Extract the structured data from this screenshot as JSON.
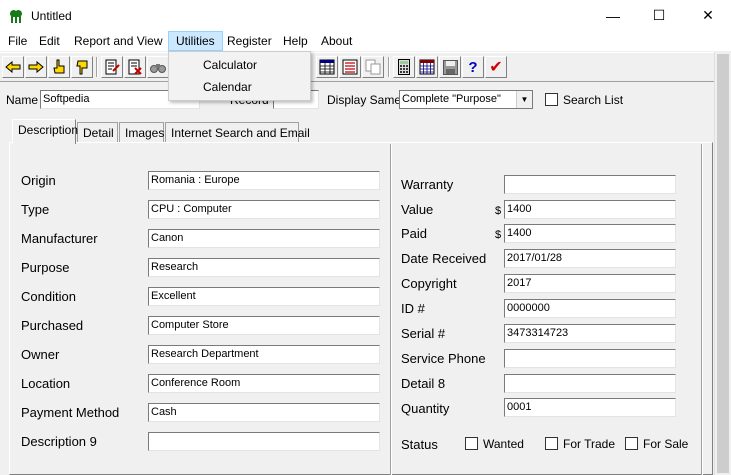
{
  "window": {
    "title": "Untitled",
    "minimize_glyph": "—",
    "maximize_glyph": "☐",
    "close_glyph": "✕"
  },
  "menu": {
    "items": [
      "File",
      "Edit",
      "Report and View",
      "Utilities",
      "Register",
      "Help",
      "About"
    ],
    "active": "Utilities"
  },
  "utilities_menu": {
    "items": [
      "Calculator",
      "Calendar"
    ]
  },
  "toolbar": {
    "icons": [
      "exit-icon",
      "enter-icon",
      "hand-pointer-icon",
      "hand-pointer-alt-icon",
      "document-edit-icon",
      "document-delete-icon",
      "binoculars-icon",
      "grid-icon",
      "list-icon",
      "copy-icon",
      "calculator-icon",
      "calendar-icon",
      "save-icon",
      "help-icon",
      "check-icon"
    ],
    "help_glyph": "?",
    "check_glyph": "✔"
  },
  "record_bar": {
    "name_label": "Name",
    "name_value": "Softpedia",
    "record_label": "Record",
    "record_value": "",
    "display_same_label": "Display Same",
    "display_same_value": "Complete \"Purpose\"",
    "search_list_label": "Search List",
    "search_list_checked": false
  },
  "tabs": [
    "Description",
    "Detail",
    "Images",
    "Internet Search and Email"
  ],
  "active_tab": "Description",
  "description": {
    "left": [
      {
        "label": "Origin",
        "value": "Romania  : Europe"
      },
      {
        "label": "Type",
        "value": "CPU : Computer"
      },
      {
        "label": "Manufacturer",
        "value": "Canon"
      },
      {
        "label": "Purpose",
        "value": "Research"
      },
      {
        "label": "Condition",
        "value": "Excellent"
      },
      {
        "label": "Purchased",
        "value": "Computer Store"
      },
      {
        "label": "Owner",
        "value": "Research Department"
      },
      {
        "label": "Location",
        "value": "Conference Room"
      },
      {
        "label": "Payment Method",
        "value": "Cash"
      },
      {
        "label": "Description 9",
        "value": ""
      }
    ],
    "right": [
      {
        "label": "Warranty",
        "value": ""
      },
      {
        "label": "Value",
        "value": "1400",
        "prefix": "$"
      },
      {
        "label": "Paid",
        "value": "1400",
        "prefix": "$"
      },
      {
        "label": "Date Received",
        "value": "2017/01/28"
      },
      {
        "label": "Copyright",
        "value": "2017"
      },
      {
        "label": "ID #",
        "value": "0000000"
      },
      {
        "label": "Serial #",
        "value": "3473314723"
      },
      {
        "label": "Service Phone",
        "value": ""
      },
      {
        "label": "Detail 8",
        "value": ""
      },
      {
        "label": "Quantity",
        "value": "0001"
      }
    ],
    "status_label": "Status",
    "status_options": [
      {
        "label": "Wanted",
        "checked": false
      },
      {
        "label": "For Trade",
        "checked": false
      },
      {
        "label": "For Sale",
        "checked": false
      }
    ]
  },
  "colors": {
    "menu_highlight": "#cce8ff",
    "app_icon_green": "#1a7a1a",
    "check_red": "#d40000",
    "help_blue": "#0000cc"
  }
}
